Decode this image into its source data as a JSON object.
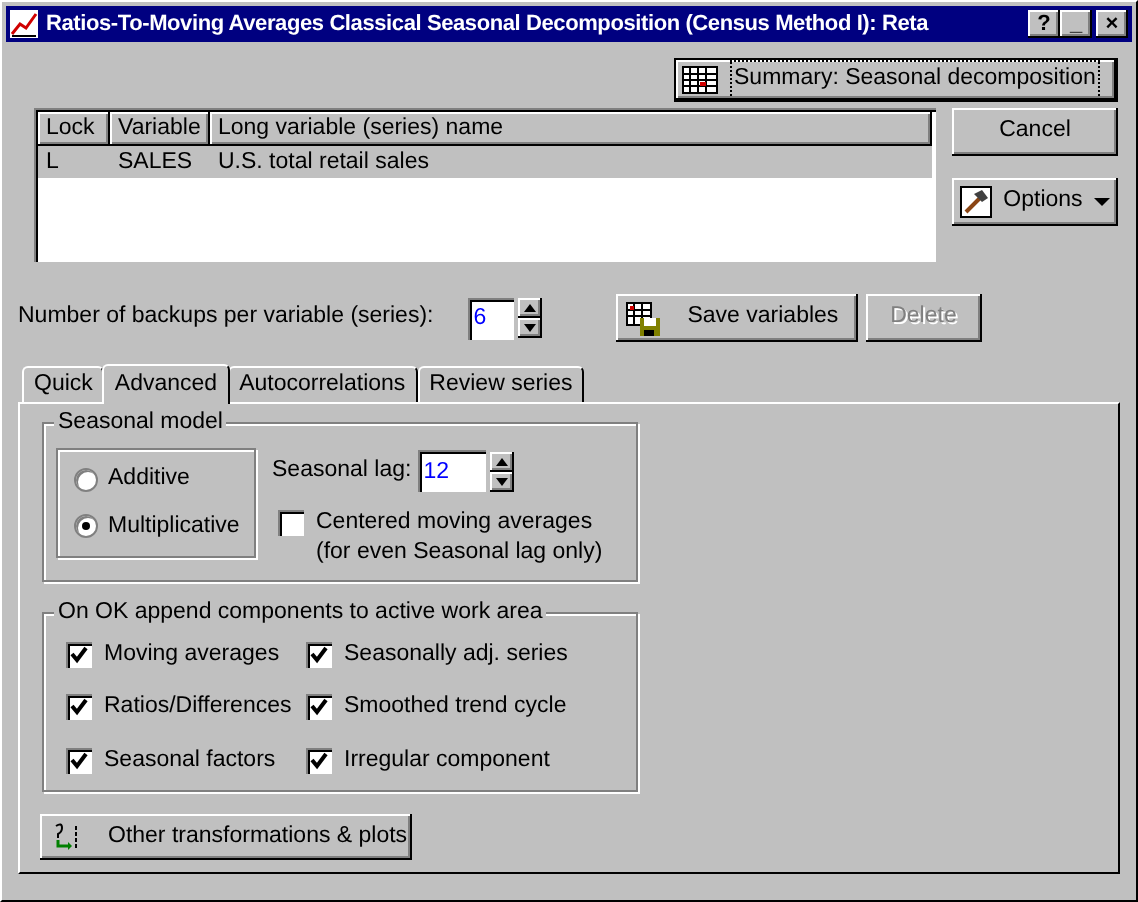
{
  "window": {
    "title": "Ratios-To-Moving Averages Classical Seasonal Decomposition (Census Method I): Reta",
    "controls": [
      "?",
      "_",
      "×"
    ]
  },
  "summary_button": {
    "label": "Summary:  Seasonal decomposition"
  },
  "table": {
    "columns": [
      "Lock",
      "Variable",
      "Long variable (series) name"
    ],
    "rows": [
      {
        "lock": "L",
        "variable": "SALES",
        "name": "U.S. total retail sales",
        "selected": true
      }
    ]
  },
  "side_buttons": [
    {
      "label": "Cancel",
      "kind": "plain"
    },
    {
      "label": "Options",
      "kind": "menu"
    }
  ],
  "backups": {
    "label": "Number of backups per variable (series):",
    "value": "6"
  },
  "save_button": {
    "label": "Save variables",
    "disabled": false
  },
  "delete_button": {
    "label": "Delete",
    "disabled": true
  },
  "tabs": [
    {
      "label": "Quick",
      "selected": false
    },
    {
      "label": "Advanced",
      "selected": true
    },
    {
      "label": "Autocorrelations",
      "selected": false
    },
    {
      "label": "Review series",
      "selected": false
    }
  ],
  "seasonal_model": {
    "title": "Seasonal model",
    "options": [
      {
        "label": "Additive",
        "selected": false
      },
      {
        "label": "Multiplicative",
        "selected": true
      }
    ],
    "lag_label": "Seasonal lag:",
    "lag_value": "12",
    "centered": {
      "lines": [
        "Centered moving averages",
        "(for even Seasonal lag only)"
      ],
      "checked": false
    }
  },
  "components": {
    "title": "On OK append components to active work area",
    "items": [
      {
        "label": "Moving averages",
        "checked": true
      },
      {
        "label": "Ratios/Differences",
        "checked": true
      },
      {
        "label": "Seasonal factors",
        "checked": true
      },
      {
        "label": "Seasonally adj. series",
        "checked": true
      },
      {
        "label": "Smoothed trend cycle",
        "checked": true
      },
      {
        "label": "Irregular component",
        "checked": true
      }
    ]
  },
  "other_button": {
    "label": "Other transformations & plots"
  }
}
